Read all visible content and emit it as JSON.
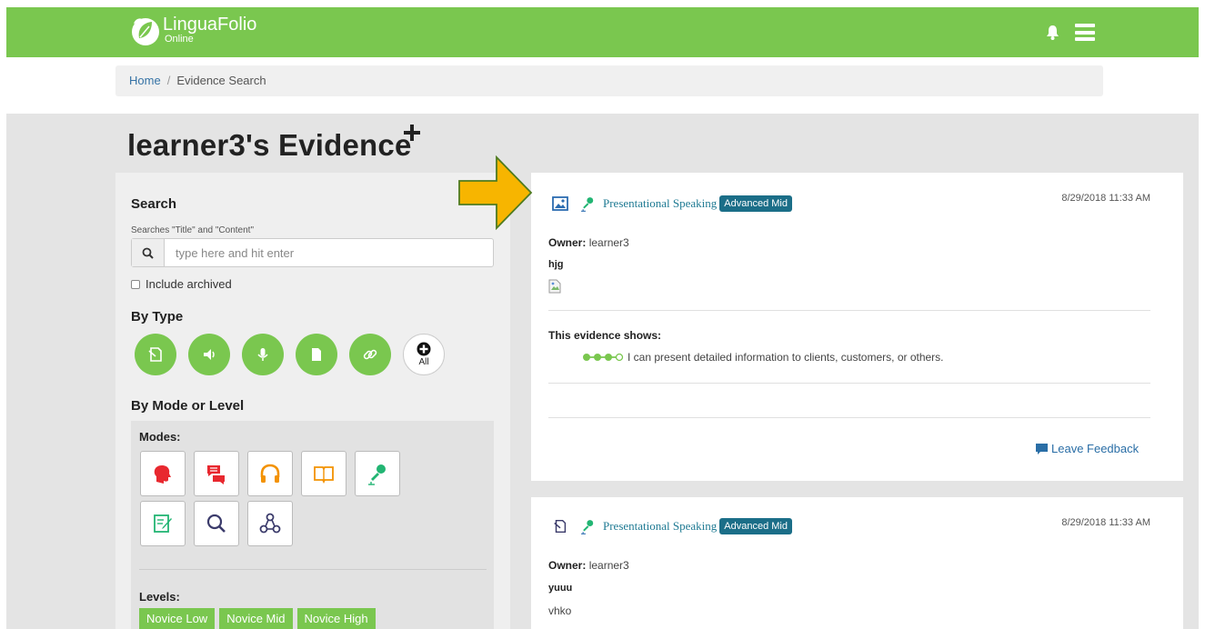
{
  "brand": {
    "name": "LinguaFolio",
    "sub": "Online",
    "green": "#7ac74f"
  },
  "header": {
    "icons": [
      "bell-icon",
      "menu-icon"
    ]
  },
  "breadcrumb": {
    "home": "Home",
    "separator": "/",
    "current": "Evidence Search"
  },
  "page": {
    "title": "learner3's Evidence",
    "add_icon": "plus-icon"
  },
  "search": {
    "heading": "Search",
    "hint": "Searches \"Title\" and \"Content\"",
    "placeholder": "type here and hit enter",
    "include_archived": "Include archived"
  },
  "by_type": {
    "heading": "By Type",
    "types": [
      "document-icon",
      "audio-icon",
      "microphone-icon",
      "file-icon",
      "link-icon"
    ],
    "all_label": "All"
  },
  "by_mode": {
    "heading": "By Mode or Level",
    "modes_label": "Modes:",
    "modes": [
      "speaking-head-icon",
      "chat-icon",
      "headphones-icon",
      "book-icon",
      "microphone-icon",
      "writing-icon",
      "magnifier-icon",
      "network-icon"
    ],
    "levels_label": "Levels:",
    "levels": [
      "Novice Low",
      "Novice Mid",
      "Novice High"
    ]
  },
  "evidence": [
    {
      "type_icon": "image-icon",
      "mode_icon": "microphone-icon",
      "skill": "Presentational Speaking",
      "level": "Advanced Mid",
      "date": "8/29/2018 11:33 AM",
      "owner_label": "Owner:",
      "owner": "learner3",
      "title": "hjg",
      "shows_label": "This evidence shows:",
      "can_do": "I can present detailed information to clients, customers, or others.",
      "progress_filled": 3,
      "progress_total": 4,
      "feedback": "Leave Feedback"
    },
    {
      "type_icon": "document-icon",
      "mode_icon": "microphone-icon",
      "skill": "Presentational Speaking",
      "level": "Advanced Mid",
      "date": "8/29/2018 11:33 AM",
      "owner_label": "Owner:",
      "owner": "learner3",
      "title": "yuuu",
      "content": "vhko"
    }
  ],
  "annotation": {
    "arrow_color": "#f7b500"
  }
}
